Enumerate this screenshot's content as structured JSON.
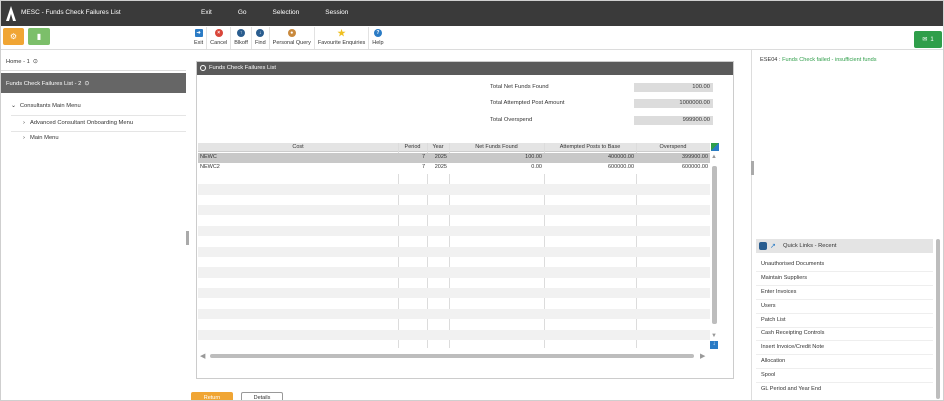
{
  "app": {
    "title": "MESC - Funds Check Failures List",
    "menu": [
      "Exit",
      "Go",
      "Selection",
      "Session"
    ]
  },
  "quick_buttons": {
    "orange_icon": "gear-icon",
    "green_icon": "chart-icon"
  },
  "toolbar": {
    "items": [
      {
        "label": "Exit",
        "icon": "exit-icon",
        "color": "#2a7bc5"
      },
      {
        "label": "Cancel",
        "icon": "cancel-icon",
        "color": "#d9463a"
      },
      {
        "label": "Blkoff",
        "icon": "blkoff-icon",
        "color": "#2a5d8f"
      },
      {
        "label": "Find",
        "icon": "find-icon",
        "color": "#2a5d8f"
      },
      {
        "label": "Personal Query",
        "icon": "person-icon",
        "color": "#c98a3e"
      },
      {
        "label": "Favourite Enquiries",
        "icon": "star-icon",
        "color": "#f0c020"
      },
      {
        "label": "Help",
        "icon": "help-icon",
        "color": "#2a7bc5"
      }
    ]
  },
  "mail": {
    "count": "1",
    "color": "#2f9e4a"
  },
  "left": {
    "home": "Home - 1",
    "breadcrumb": "Funds Check Failures List - 2",
    "main_menu": "Consultants Main Menu",
    "items": [
      "Advanced Consultant Onboarding Menu",
      "Main Menu"
    ]
  },
  "panel": {
    "title": "Funds Check Failures List",
    "summary": [
      {
        "label": "Total Net Funds Found",
        "value": "100.00"
      },
      {
        "label": "Total Attempted Post Amount",
        "value": "1000000.00"
      },
      {
        "label": "Total Overspend",
        "value": "999900.00"
      }
    ],
    "columns": [
      "Cost",
      "Period",
      "Year",
      "Net Funds Found",
      "Attempted Posts to Base",
      "Overspend"
    ],
    "rows": [
      {
        "cost": "NEWC",
        "period": "7",
        "year": "2025",
        "net": "100.00",
        "attempted": "400000.00",
        "overspend": "399900.00"
      },
      {
        "cost": "NEWC2",
        "period": "7",
        "year": "2025",
        "net": "0.00",
        "attempted": "600000.00",
        "overspend": "600000.00"
      }
    ],
    "submit": "Return",
    "cancel": "Details"
  },
  "right": {
    "message_code": "ESE04 :",
    "message_text": "Funds Check failed - insufficient funds",
    "quick_links_title": "Quick Links - Recent",
    "links": [
      "Unauthorised Documents",
      "Maintain Suppliers",
      "Enter Invoices",
      "Users",
      "Patch List",
      "Cash Receipting Controls",
      "Insert Invoice/Credit Note",
      "Allocation",
      "Spool",
      "GL Period and Year End"
    ]
  }
}
